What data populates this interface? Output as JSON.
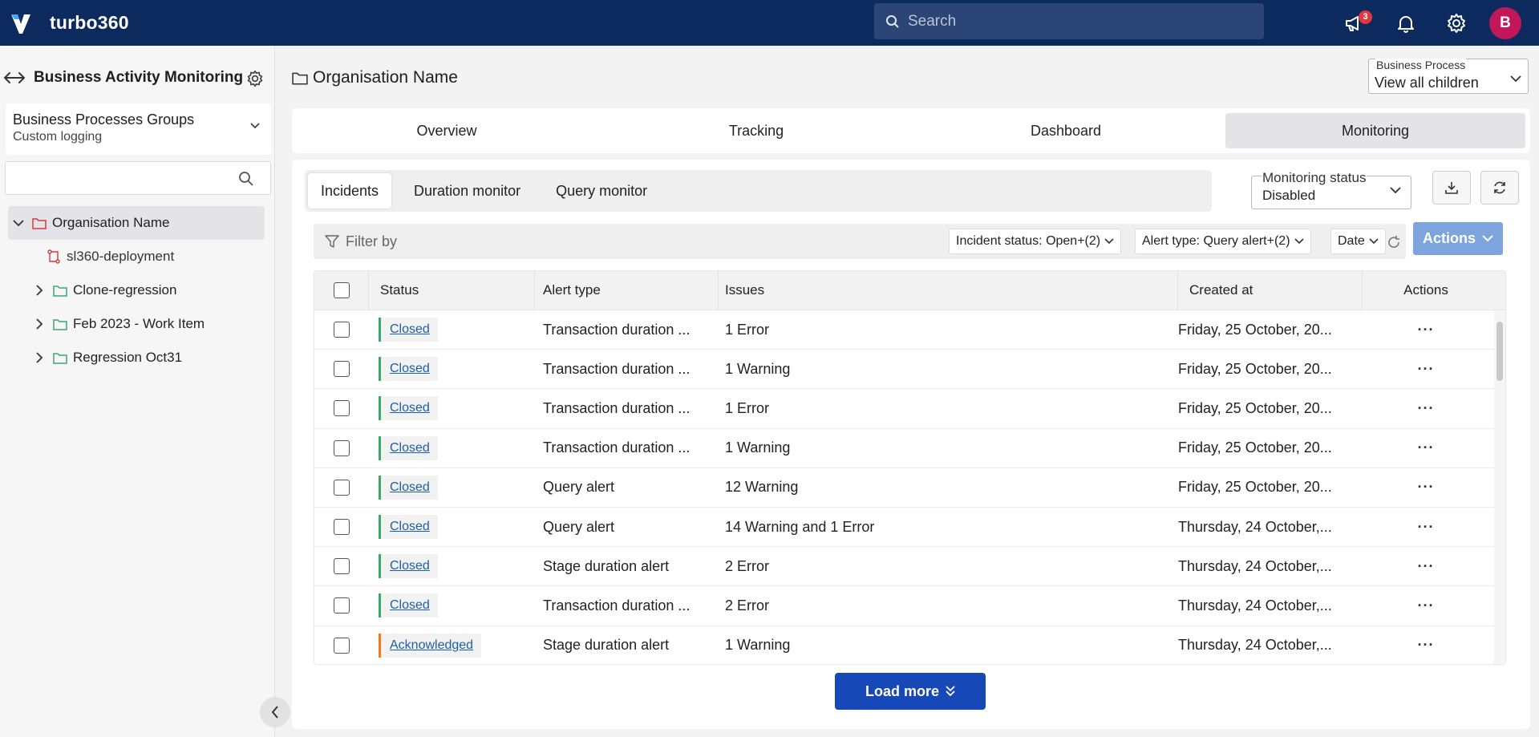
{
  "topbar": {
    "brand": "turbo360",
    "search_placeholder": "Search",
    "notification_count": "3",
    "avatar_initial": "B"
  },
  "sidebar": {
    "title": "Business Activity Monitoring",
    "group_title": "Business Processes Groups",
    "group_subtitle": "Custom logging",
    "search_placeholder": "",
    "tree": [
      {
        "label": "Organisation Name",
        "expanded": true,
        "selected": true
      },
      {
        "label": "sl360-deployment"
      },
      {
        "label": "Clone-regression"
      },
      {
        "label": "Feb 2023 - Work Item"
      },
      {
        "label": "Regression Oct31"
      }
    ]
  },
  "main": {
    "org_name": "Organisation Name",
    "business_process": {
      "label": "Business Process",
      "value": "View all children"
    },
    "tabs": [
      "Overview",
      "Tracking",
      "Dashboard",
      "Monitoring"
    ],
    "active_tab": "Monitoring",
    "sub_tabs": [
      "Incidents",
      "Duration monitor",
      "Query monitor"
    ],
    "monitoring_status": {
      "label": "Monitoring status",
      "value": "Disabled"
    },
    "filter": {
      "label": "Filter by",
      "chips": [
        "Incident status: Open+(2)",
        "Alert type: Query alert+(2)",
        "Date"
      ]
    },
    "actions_label": "Actions",
    "table": {
      "headers": [
        "Status",
        "Alert type",
        "Issues",
        "Created at",
        "Actions"
      ],
      "rows": [
        {
          "status": "Closed",
          "alert_type": "Transaction duration ...",
          "issues": "1 Error",
          "created": "Friday, 25 October, 20..."
        },
        {
          "status": "Closed",
          "alert_type": "Transaction duration ...",
          "issues": "1 Warning",
          "created": "Friday, 25 October, 20..."
        },
        {
          "status": "Closed",
          "alert_type": "Transaction duration ...",
          "issues": "1 Error",
          "created": "Friday, 25 October, 20..."
        },
        {
          "status": "Closed",
          "alert_type": "Transaction duration ...",
          "issues": "1 Warning",
          "created": "Friday, 25 October, 20..."
        },
        {
          "status": "Closed",
          "alert_type": "Query alert",
          "issues": "12 Warning",
          "created": "Friday, 25 October, 20..."
        },
        {
          "status": "Closed",
          "alert_type": "Query alert",
          "issues": "14 Warning and 1 Error",
          "created": "Thursday, 24 October,..."
        },
        {
          "status": "Closed",
          "alert_type": "Stage duration alert",
          "issues": "2 Error",
          "created": "Thursday, 24 October,..."
        },
        {
          "status": "Closed",
          "alert_type": "Transaction duration ...",
          "issues": "2 Error",
          "created": "Thursday, 24 October,..."
        },
        {
          "status": "Acknowledged",
          "alert_type": "Stage duration alert",
          "issues": "1 Warning",
          "created": "Thursday, 24 October,..."
        }
      ],
      "row_action": "···"
    },
    "load_more": "Load more"
  },
  "colors": {
    "topbar": "#0c2a5e",
    "closed_accent": "#3aa76d",
    "acknowledged_accent": "#f07c1b",
    "primary_button": "#1748b8",
    "actions_button": "#7ea4de"
  }
}
